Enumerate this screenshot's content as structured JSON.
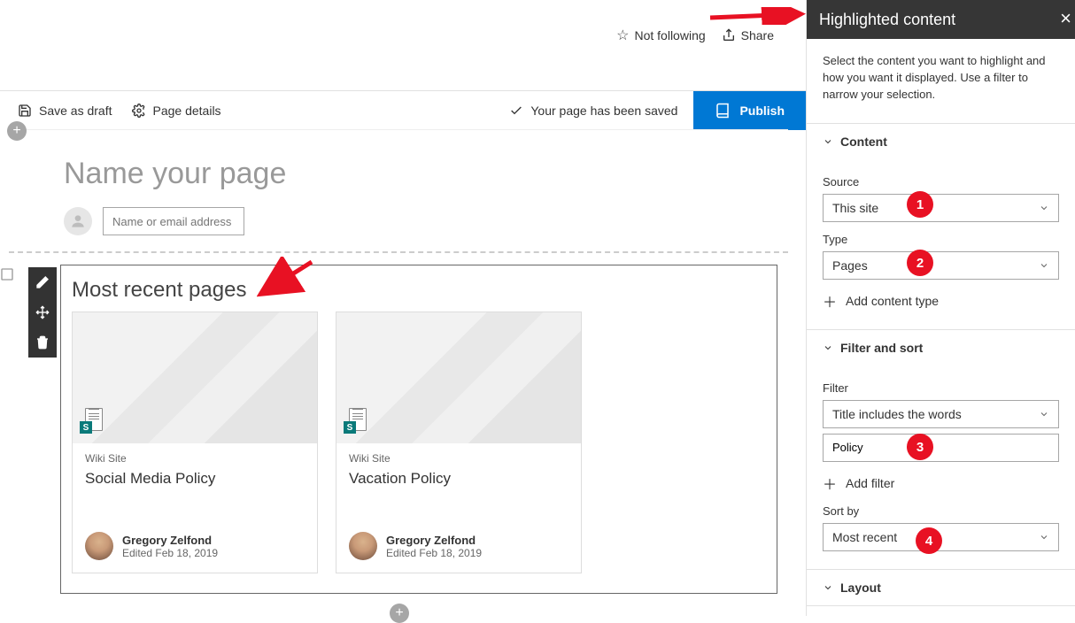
{
  "topbar": {
    "not_following_label": "Not following",
    "share_label": "Share"
  },
  "commandbar": {
    "save_draft_label": "Save as draft",
    "page_details_label": "Page details",
    "saved_msg": "Your page has been saved",
    "publish_label": "Publish"
  },
  "page": {
    "title_placeholder": "Name your page",
    "author_input_placeholder": "Name or email address"
  },
  "webpart": {
    "title": "Most recent pages",
    "cards": [
      {
        "site": "Wiki Site",
        "title": "Social Media Policy",
        "author": "Gregory Zelfond",
        "modified": "Edited Feb 18, 2019",
        "badge": "S"
      },
      {
        "site": "Wiki Site",
        "title": "Vacation Policy",
        "author": "Gregory Zelfond",
        "modified": "Edited Feb 18, 2019",
        "badge": "S"
      }
    ]
  },
  "panel": {
    "title": "Highlighted content",
    "description": "Select the content you want to highlight and how you want it displayed. Use a filter to narrow your selection.",
    "sections": {
      "content": "Content",
      "filter_sort": "Filter and sort",
      "layout": "Layout"
    },
    "content": {
      "source_label": "Source",
      "source_value": "This site",
      "type_label": "Type",
      "type_value": "Pages",
      "add_content_type_label": "Add content type"
    },
    "filter_sort": {
      "filter_label": "Filter",
      "filter_select_value": "Title includes the words",
      "filter_text_value": "Policy",
      "add_filter_label": "Add filter",
      "sort_label": "Sort by",
      "sort_value": "Most recent"
    }
  },
  "annotations": {
    "badges": [
      "1",
      "2",
      "3",
      "4"
    ]
  },
  "colors": {
    "primary": "#0078d4",
    "badge_red": "#e81123",
    "panel_header": "#363636"
  }
}
